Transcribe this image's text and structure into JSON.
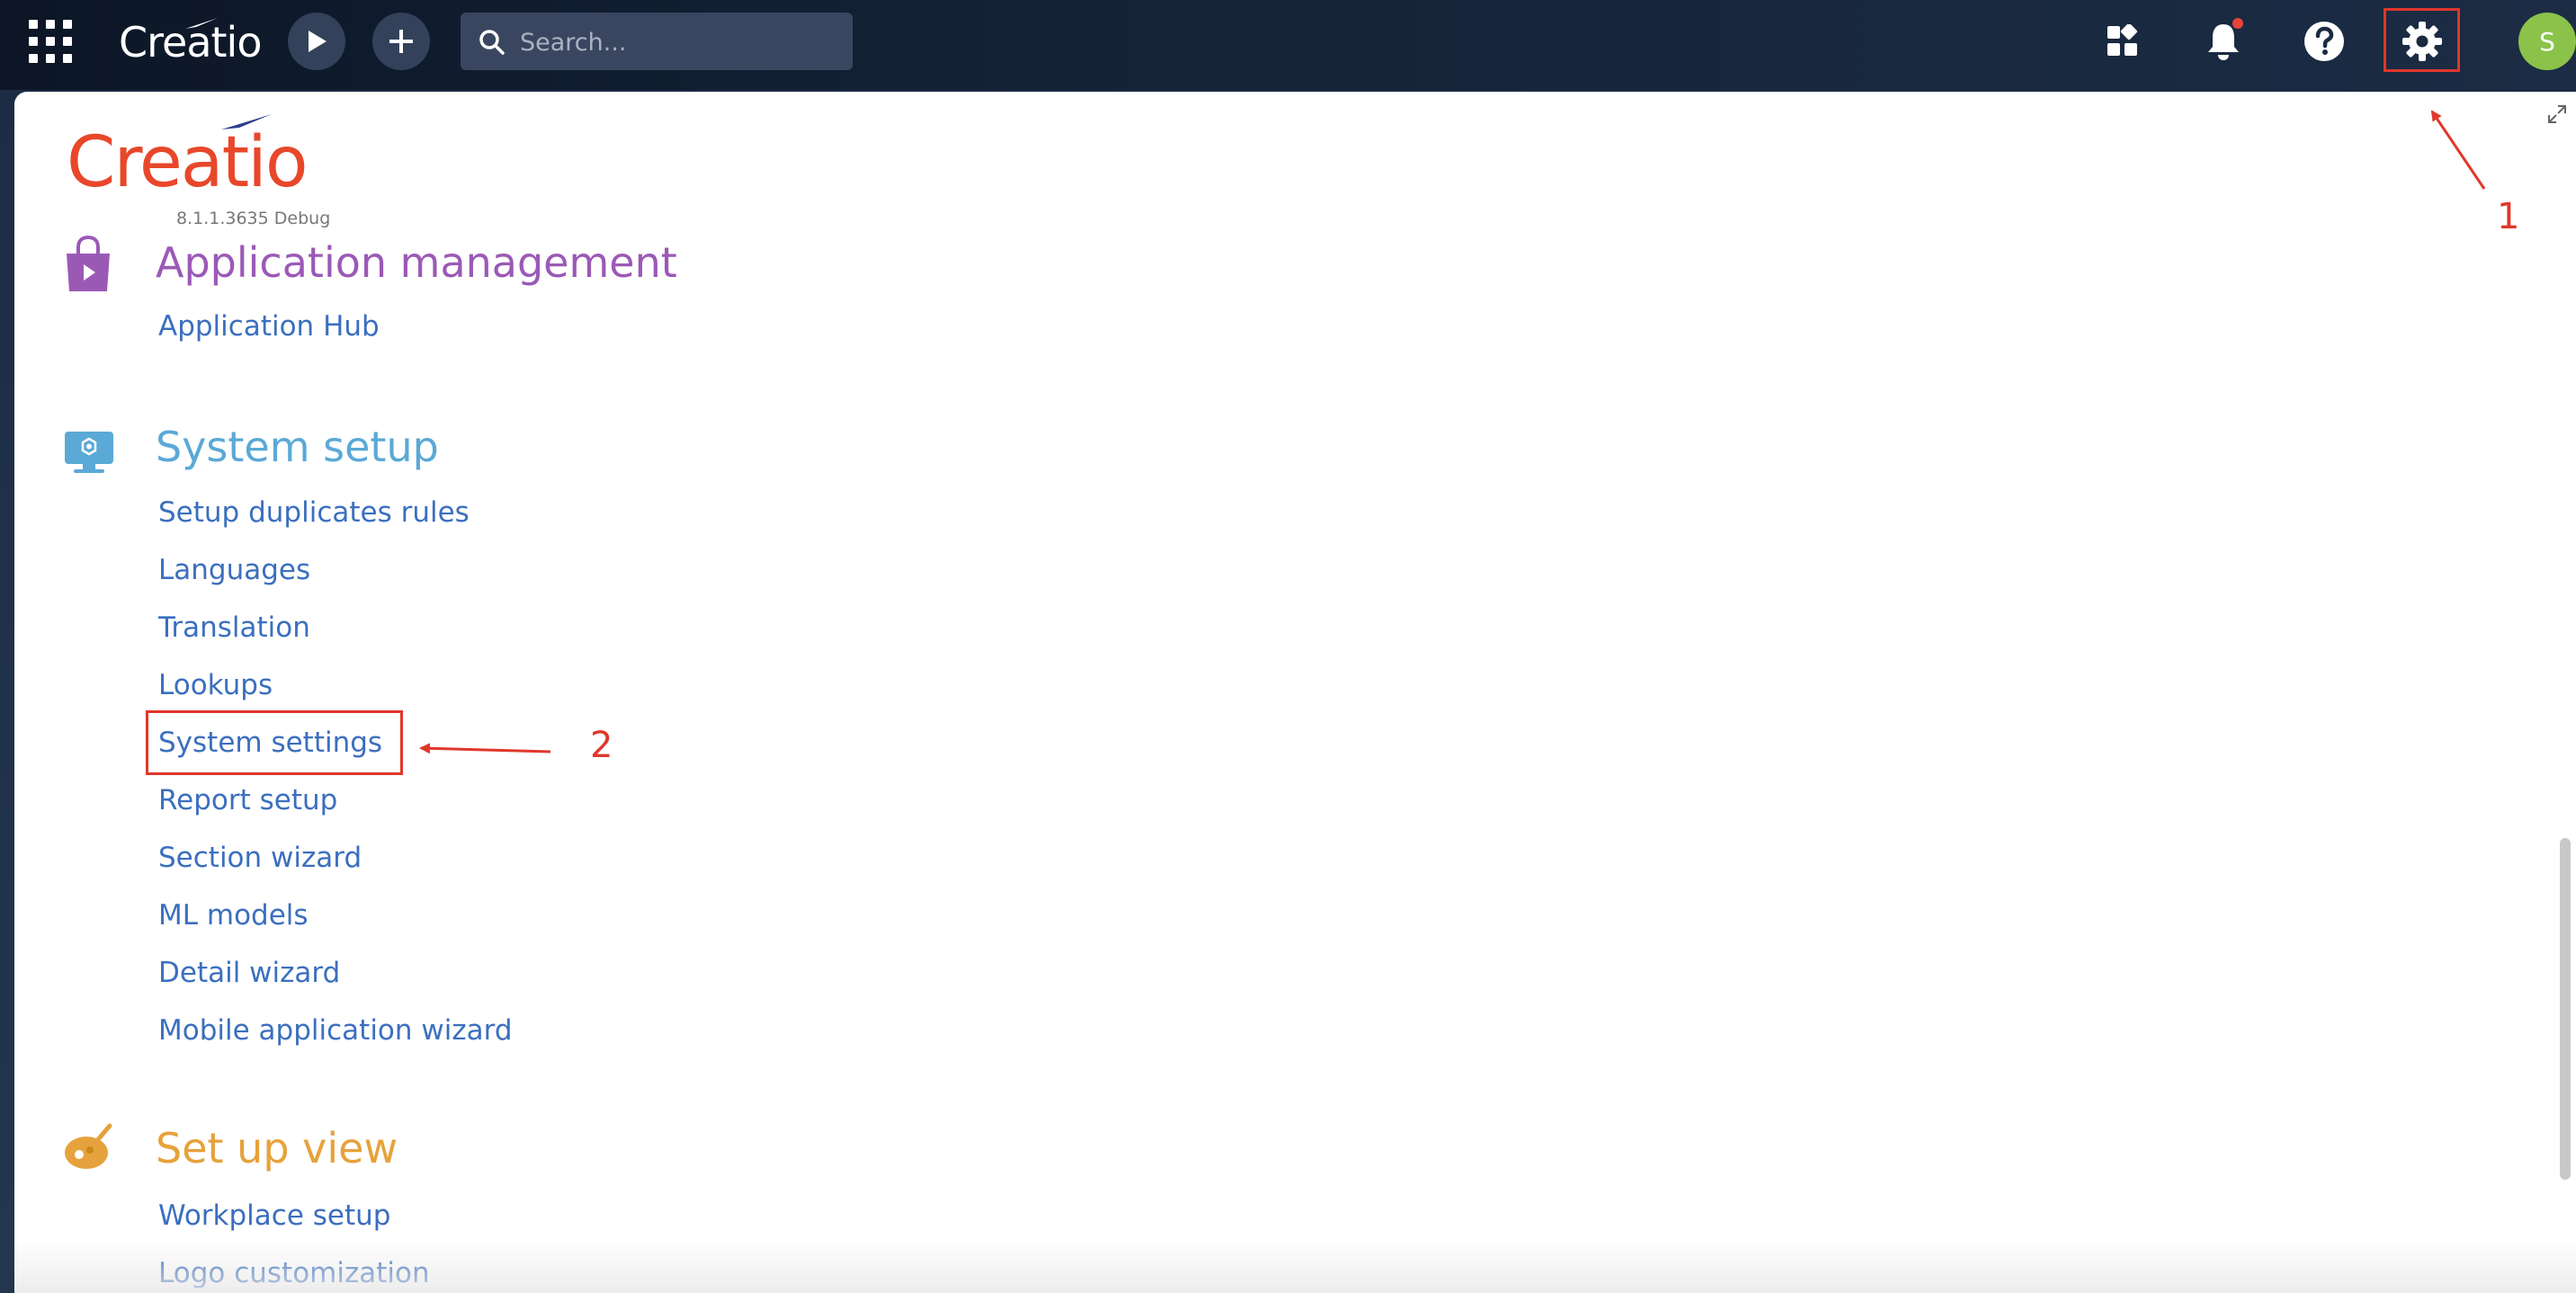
{
  "topbar": {
    "logo_text": "Creatio",
    "search": {
      "placeholder": "Search..."
    },
    "avatar_initial": "S"
  },
  "brand": {
    "name": "Creatio",
    "version": "8.1.1.3635 Debug"
  },
  "sections": [
    {
      "title": "Application management",
      "color": "#9b59b6",
      "links": [
        "Application Hub"
      ]
    },
    {
      "title": "System setup",
      "color": "#5aa9d6",
      "links": [
        "Setup duplicates rules",
        "Languages",
        "Translation",
        "Lookups",
        "System settings",
        "Report setup",
        "Section wizard",
        "ML models",
        "Detail wizard",
        "Mobile application wizard"
      ]
    },
    {
      "title": "Set up view",
      "color": "#e6a23c",
      "links": [
        "Workplace setup",
        "Logo customization"
      ]
    }
  ],
  "annotations": {
    "step1": "1",
    "step2": "2",
    "color": "#e0372b"
  },
  "colors": {
    "link": "#3b6fbf",
    "brand": "#e8472a",
    "avatar": "#8bc34a"
  }
}
